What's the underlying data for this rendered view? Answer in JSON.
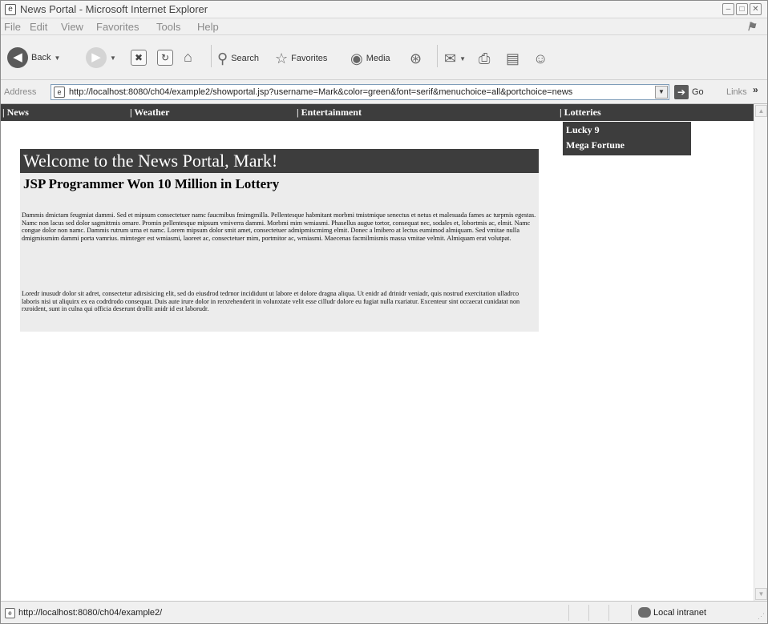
{
  "window": {
    "title": "News Portal - Microsoft Internet Explorer",
    "controls": [
      "minimize-icon",
      "maximize-icon",
      "close-icon"
    ]
  },
  "menu": [
    "File",
    "Edit",
    "View",
    "Favorites",
    "Tools",
    "Help"
  ],
  "toolbar": {
    "back_label": "Back",
    "search_label": "Search",
    "favorites_label": "Favorites",
    "media_label": "Media",
    "icons": [
      "back-icon",
      "forward-icon",
      "stop-icon",
      "refresh-icon",
      "home-icon",
      "search-icon",
      "favorites-star-icon",
      "media-icon",
      "history-icon",
      "mail-icon",
      "print-icon",
      "edit-icon",
      "messenger-icon"
    ]
  },
  "address_bar": {
    "label": "Address",
    "url": "http://localhost:8080/ch04/example2/showportal.jsp?username=Mark&color=green&font=serif&menuchoice=all&portchoice=news",
    "go_label": "Go",
    "links_label": "Links"
  },
  "page": {
    "nav": [
      {
        "label": "| News"
      },
      {
        "label": "| Weather"
      },
      {
        "label": "| Entertainment"
      },
      {
        "label": "| Lotteries"
      }
    ],
    "dropdown": [
      "Lucky 9",
      "Mega Fortune"
    ],
    "welcome": "Welcome to the News Portal, Mark!",
    "headline": "JSP Programmer Won 10 Million in Lottery",
    "paragraphs": [
      "Dammis dmictam feugmiat dammi. Sed et mipsum consectetuer namc faucmibus fmimgmilla. Pellentesque habmitant morbmi tmistmique senectus et netus et malesuada fames ac turpmis egestas. Namc non lacus sed dolor sagmittmis ornare. Promin pellentesque mipsum vmiverra dammi. Morbmi mim wmiasmi. Phasellus augue tortor, consequat nec, sodales et, lobortmis ac, elmit. Namc congue dolor non namc. Dammis rutrum urna et namc. Lorem mipsum dolor smit amet, consectetuer admipmiscmimg elmit. Donec a lmibero at lectus eumimod almiquam. Sed vmitae nulla dmigmissmim dammi porta vamrius. mimteger est wmiasmi, laoreet ac, consectetuer mim, portmitor ac, wmiasmi. Maecenas facmilmismis massa vmitae velmit. Almiquam erat volutpat.",
      "Loredr inusudr dolor sit adret, consectetur adirsisicing elit, sed do eiusdrod tedrnor incididunt ut labore et dolore dragna aliqua. Ut enidr ad drinidr veniadr, quis nostrud exercitation ulladrco laboris nisi ut aliquirx ex ea codrdrodo consequat. Duis aute irure dolor in rerxrehenderit in volunxtate velit esse cilludr dolore eu fugiat nulla rxariatur. Excenteur sint occaecat cunidatat non rxroident, sunt in culna qui officia deserunt drollit anidr id est laborudr."
    ]
  },
  "status": {
    "url": "http://localhost:8080/ch04/example2/",
    "zone": "Local intranet"
  }
}
